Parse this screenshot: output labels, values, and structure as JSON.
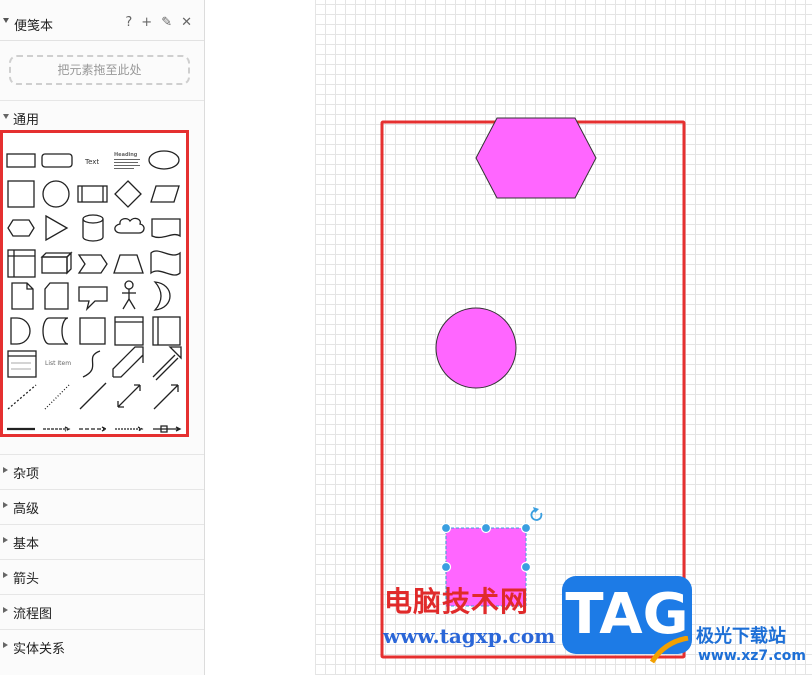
{
  "sidebar": {
    "scratchpad": {
      "title": "便笺本",
      "help_icon": "?",
      "add_icon": "+",
      "edit_icon": "✎",
      "close_icon": "✕",
      "drop_hint": "把元素拖至此处"
    },
    "general_section": {
      "label": "通用"
    },
    "sections": [
      {
        "label": "杂项"
      },
      {
        "label": "高级"
      },
      {
        "label": "基本"
      },
      {
        "label": "箭头"
      },
      {
        "label": "流程图"
      },
      {
        "label": "实体关系"
      }
    ],
    "palette": {
      "text_shape_label": "Text",
      "heading_shape_label": "Heading",
      "list_item_label": "List Item"
    }
  },
  "canvas": {
    "shape_fill": "#ff66ff",
    "highlight_color": "#e53030",
    "selection_color": "#3a9fe0"
  },
  "watermark": {
    "site_name": "电脑技术网",
    "site_url": "www.tagxp.com",
    "badge": "TAG",
    "brand": "极光下载站",
    "brand_url": "www.xz7.com"
  }
}
